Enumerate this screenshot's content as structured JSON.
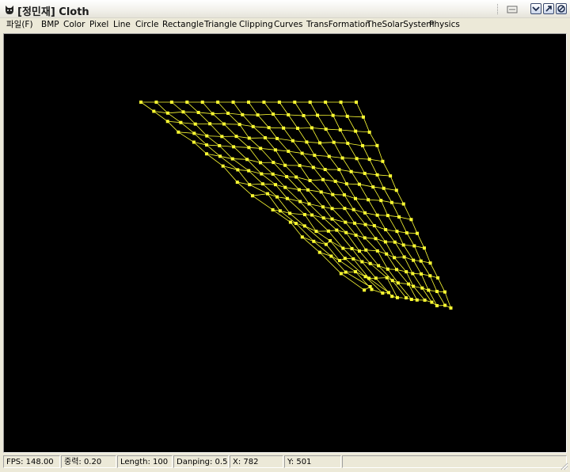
{
  "window": {
    "title": "[정민재] Cloth",
    "icon": "cat-app-icon"
  },
  "titlebar_buttons": [
    "minimize-icon",
    "maximize-icon",
    "close-icon"
  ],
  "menu": {
    "items": [
      "파일(F)",
      "BMP",
      "Color",
      "Pixel",
      "Line",
      "Circle",
      "Rectangle",
      "Triangle",
      "Clipping",
      "Curves",
      "TransFormation",
      "TheSolarSystem",
      "Physics"
    ]
  },
  "canvas": {
    "background": "#000000",
    "cloth_color": "#ffff33",
    "cloth_grid": {
      "columns": 15,
      "rows": 15
    }
  },
  "status": {
    "fps": "FPS: 148.00",
    "gravity": "중력: 0.20",
    "length": "Length: 100",
    "damping": "Danping: 0.50",
    "x": "X: 782",
    "y": "Y: 501"
  }
}
